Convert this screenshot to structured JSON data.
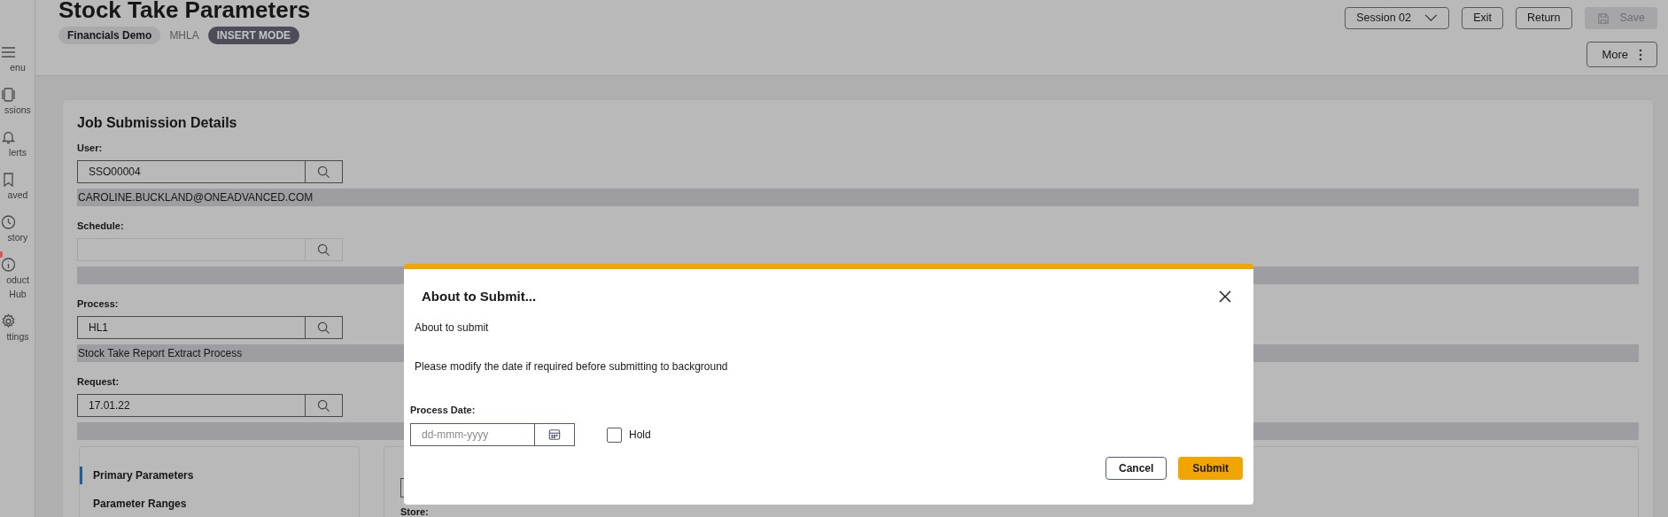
{
  "nav": [
    {
      "label": "enu",
      "badge": false
    },
    {
      "label": "ssions",
      "badge": false
    },
    {
      "label": "lerts",
      "badge": false
    },
    {
      "label": "aved",
      "badge": false
    },
    {
      "label": "story",
      "badge": false
    },
    {
      "label": "oduct Hub",
      "badge": true
    },
    {
      "label": "ttings",
      "badge": false
    }
  ],
  "header": {
    "title": "Stock Take Parameters",
    "tags": [
      {
        "label": "Financials Demo",
        "kind": "chip"
      },
      {
        "label": "MHLA",
        "kind": "text"
      },
      {
        "label": "INSERT MODE",
        "kind": "mode"
      }
    ],
    "session": "Session 02",
    "buttons": [
      {
        "label": "Exit",
        "disabled": false
      },
      {
        "label": "Return",
        "disabled": false
      },
      {
        "label": "Save",
        "disabled": true
      }
    ],
    "more": "More"
  },
  "card": {
    "title": "Job Submission Details",
    "fields": [
      {
        "label": "User:",
        "value": "SSO00004",
        "description": "CAROLINE.BUCKLAND@ONEADVANCED.COM"
      },
      {
        "label": "Schedule:"
      },
      {
        "label": "Process:",
        "value": "HL1",
        "description": "Stock Take Report Extract Process"
      },
      {
        "label": "Request:",
        "value": "17.01.22"
      }
    ]
  },
  "sections": [
    {
      "label": "Primary Parameters",
      "selected": true
    },
    {
      "label": "Parameter Ranges",
      "selected": false
    }
  ],
  "parameters": {
    "store_label": "Store:"
  },
  "dialog": {
    "title": "About to Submit...",
    "messages": [
      "About to submit",
      "Please modify the date if required before submitting to background"
    ],
    "date_label": "Process Date:",
    "date_placeholder": "dd-mmm-yyyy",
    "hold": {
      "label": "Hold",
      "checked": false
    },
    "buttons": [
      {
        "label": "Cancel",
        "kind": "secondary"
      },
      {
        "label": "Submit",
        "kind": "primary"
      }
    ]
  }
}
